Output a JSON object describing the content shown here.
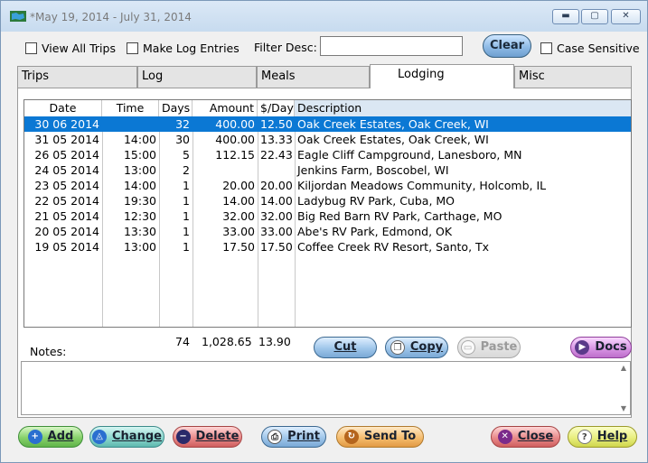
{
  "window": {
    "title": "*May 19, 2014 - July 31, 2014",
    "btn_min": "▬",
    "btn_max": "▢",
    "btn_close": "✕"
  },
  "filters": {
    "view_all_trips": "View All Trips",
    "make_log_entries": "Make Log Entries",
    "filter_desc_label": "Filter Desc:",
    "filter_desc_value": "",
    "clear": "Clear",
    "case_sensitive": "Case Sensitive"
  },
  "tabs": [
    {
      "label": "Trips"
    },
    {
      "label": "Log"
    },
    {
      "label": "Meals"
    },
    {
      "label": "Lodging"
    },
    {
      "label": "Misc"
    }
  ],
  "active_tab": "Lodging",
  "table": {
    "headers": [
      "Date",
      "Time",
      "Days",
      "Amount",
      "$/Day",
      "Description"
    ],
    "rows": [
      [
        "30 06 2014",
        "",
        "32",
        "400.00",
        "12.50",
        "Oak Creek Estates, Oak Creek, WI"
      ],
      [
        "31 05 2014",
        "14:00",
        "30",
        "400.00",
        "13.33",
        "Oak Creek Estates, Oak Creek, WI"
      ],
      [
        "26 05 2014",
        "15:00",
        "5",
        "112.15",
        "22.43",
        "Eagle Cliff Campground, Lanesboro, MN"
      ],
      [
        "24 05 2014",
        "13:00",
        "2",
        "",
        "",
        "Jenkins Farm, Boscobel, WI"
      ],
      [
        "23 05 2014",
        "14:00",
        "1",
        "20.00",
        "20.00",
        "Kiljordan Meadows Community, Holcomb, IL"
      ],
      [
        "22 05 2014",
        "19:30",
        "1",
        "14.00",
        "14.00",
        "Ladybug RV Park, Cuba, MO"
      ],
      [
        "21 05 2014",
        "12:30",
        "1",
        "32.00",
        "32.00",
        "Big Red Barn RV Park, Carthage, MO"
      ],
      [
        "20 05 2014",
        "13:30",
        "1",
        "33.00",
        "33.00",
        "Abe's RV Park, Edmond, OK"
      ],
      [
        "19 05 2014",
        "13:00",
        "1",
        "17.50",
        "17.50",
        "Coffee Creek RV Resort, Santo, Tx"
      ]
    ],
    "selected_row": 0
  },
  "totals": {
    "days": "74",
    "amount": "1,028.65",
    "per_day": "13.90"
  },
  "actions": {
    "cut": "Cut",
    "copy": "Copy",
    "paste": "Paste",
    "docs": "Docs"
  },
  "notes": {
    "label": "Notes:",
    "value": ""
  },
  "bottom": {
    "add": "Add",
    "change": "Change",
    "delete": "Delete",
    "print": "Print",
    "send_to": "Send To",
    "close": "Close",
    "help": "Help"
  }
}
